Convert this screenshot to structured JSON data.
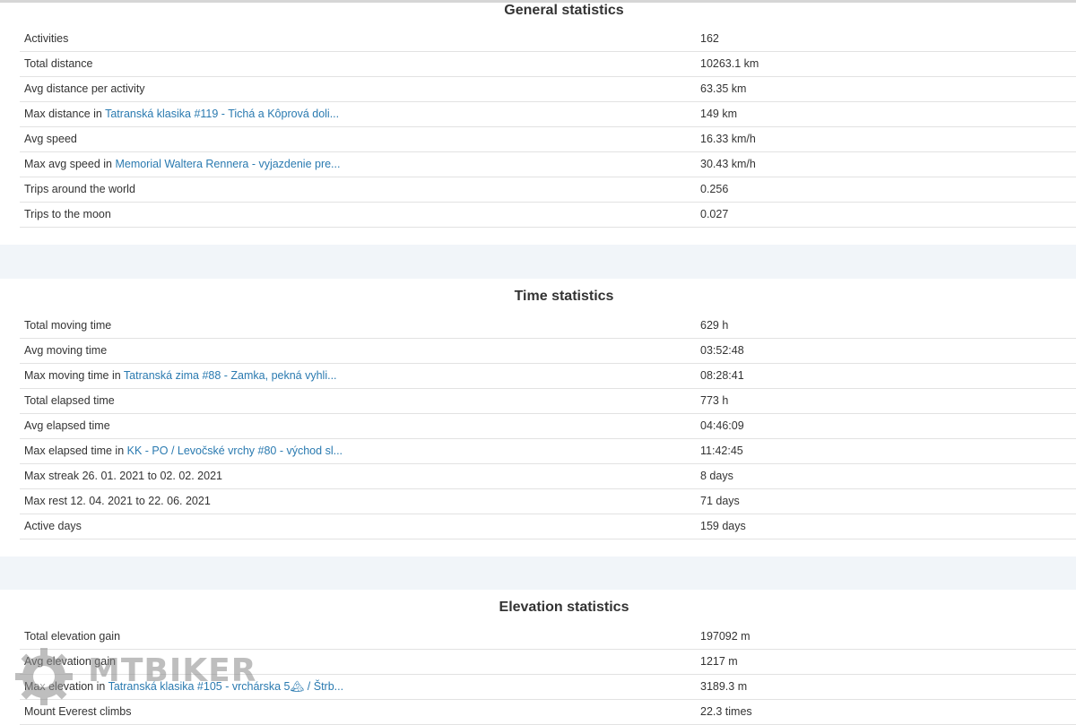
{
  "general": {
    "title": "General statistics",
    "rows": [
      {
        "label": "Activities",
        "value": "162"
      },
      {
        "label": "Total distance",
        "value": "10263.1 km"
      },
      {
        "label": "Avg distance per activity",
        "value": "63.35 km"
      },
      {
        "label": "Max distance in ",
        "link": "Tatranská klasika #119 - Tichá a Kôprová doli...",
        "value": "149 km"
      },
      {
        "label": "Avg speed",
        "value": "16.33 km/h"
      },
      {
        "label": "Max avg speed in ",
        "link": "Memorial Waltera Rennera - vyjazdenie pre...",
        "value": "30.43 km/h"
      },
      {
        "label": "Trips around the world",
        "value": "0.256"
      },
      {
        "label": "Trips to the moon",
        "value": "0.027"
      }
    ]
  },
  "time": {
    "title": "Time statistics",
    "rows": [
      {
        "label": "Total moving time",
        "value": "629 h"
      },
      {
        "label": "Avg moving time",
        "value": "03:52:48"
      },
      {
        "label": "Max moving time in ",
        "link": "Tatranská zima #88 - Zamka, pekná vyhli...",
        "value": "08:28:41"
      },
      {
        "label": "Total elapsed time",
        "value": "773 h"
      },
      {
        "label": "Avg elapsed time",
        "value": "04:46:09"
      },
      {
        "label": "Max elapsed time in ",
        "link": "KK - PO / Levočské vrchy #80 - východ sl...",
        "value": "11:42:45"
      },
      {
        "label": "Max streak 26. 01. 2021 to 02. 02. 2021",
        "value": "8 days"
      },
      {
        "label": "Max rest 12. 04. 2021 to 22. 06. 2021",
        "value": "71 days"
      },
      {
        "label": "Active days",
        "value": "159 days"
      }
    ]
  },
  "elevation": {
    "title": "Elevation statistics",
    "rows": [
      {
        "label": "Total elevation gain",
        "value": "197092 m"
      },
      {
        "label": "Avg elevation gain",
        "value": "1217 m"
      },
      {
        "label": "Max elevation in ",
        "link": "Tatranská klasika #105 - vrchárska 5🏔 / Štrb...",
        "value": "3189.3 m"
      },
      {
        "label": "Mount Everest climbs",
        "value": "22.3 times"
      }
    ]
  },
  "watermark": {
    "text": "MTBIKER",
    "icon": "gear-icon",
    "color": "#8a8a8a"
  },
  "colors": {
    "link": "#2a7ab0",
    "gap": "#f1f5f9",
    "divider": "#e2e2e2"
  }
}
